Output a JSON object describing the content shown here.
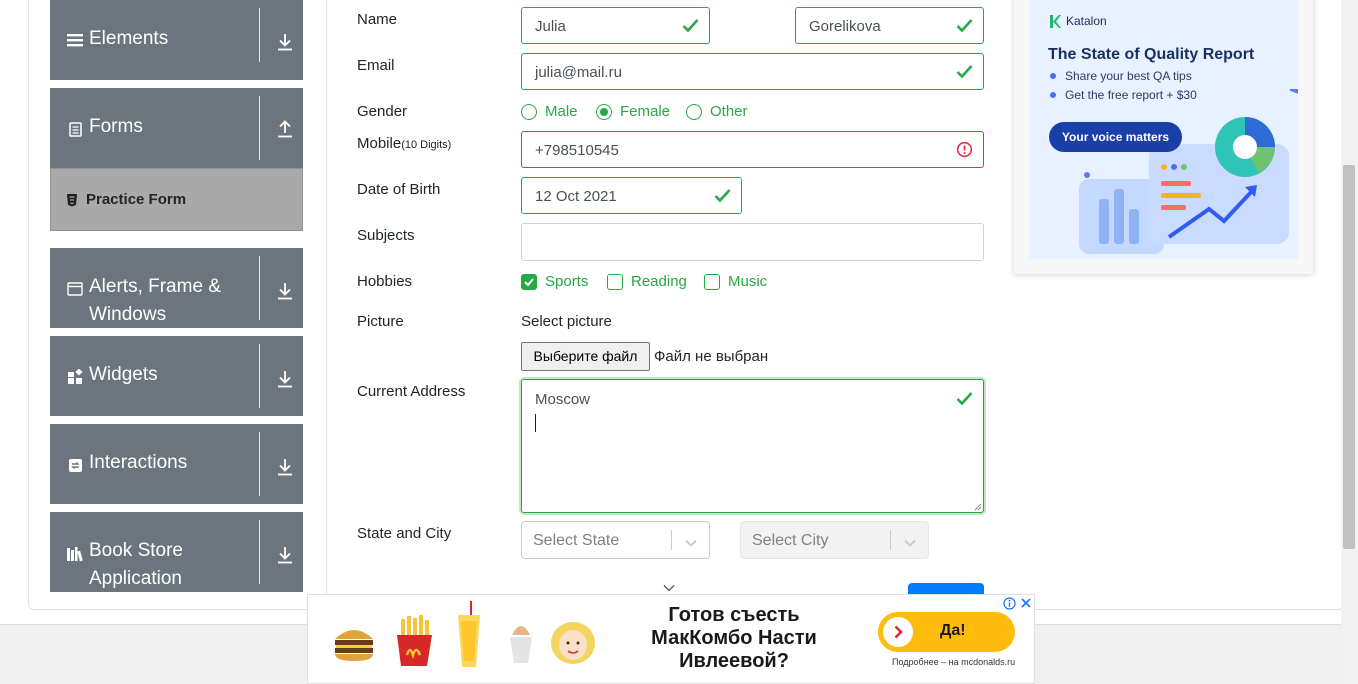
{
  "sidebar": {
    "groups": [
      {
        "label": "Elements",
        "icon": "hamburger-icon",
        "state": "collapsed"
      },
      {
        "label": "Forms",
        "icon": "document-icon",
        "state": "expanded"
      },
      {
        "label": "Alerts, Frame &",
        "label2": "Windows",
        "icon": "window-icon",
        "state": "collapsed"
      },
      {
        "label": "Widgets",
        "icon": "widgets-icon",
        "state": "collapsed"
      },
      {
        "label": "Interactions",
        "icon": "interactions-icon",
        "state": "collapsed"
      },
      {
        "label": "Book Store",
        "label2": "Application",
        "icon": "books-icon",
        "state": "collapsed"
      }
    ],
    "active_item": "Practice Form"
  },
  "form": {
    "name_label": "Name",
    "first_name": "Julia",
    "last_name": "Gorelikova",
    "email_label": "Email",
    "email": "julia@mail.ru",
    "gender_label": "Gender",
    "gender_options": [
      "Male",
      "Female",
      "Other"
    ],
    "gender_selected": "Female",
    "mobile_label": "Mobile",
    "mobile_hint": "(10 Digits)",
    "mobile": "+798510545",
    "dob_label": "Date of Birth",
    "dob": "12 Oct 2021",
    "subjects_label": "Subjects",
    "subjects": "",
    "hobbies_label": "Hobbies",
    "hobbies": [
      {
        "label": "Sports",
        "checked": true
      },
      {
        "label": "Reading",
        "checked": false
      },
      {
        "label": "Music",
        "checked": false
      }
    ],
    "picture_label": "Picture",
    "picture_prompt": "Select picture",
    "file_button": "Выберите файл",
    "file_status": "Файл не выбран",
    "address_label": "Current Address",
    "address": "Moscow",
    "state_city_label": "State and City",
    "state_placeholder": "Select State",
    "city_placeholder": "Select City"
  },
  "ad_right": {
    "brand": "Katalon",
    "title": "The State of Quality Report",
    "bullets": [
      "Share your best QA tips",
      "Get the free report + $30"
    ],
    "cta": "Your voice matters"
  },
  "ad_bottom": {
    "headline_lines": [
      "Готов съесть",
      "МакКомбо Насти",
      "Ивлеевой?"
    ],
    "button": "Да!",
    "note": "Подробнее – на mcdonalds.ru"
  },
  "colors": {
    "sidebar": "#6c757d",
    "sidebar_active": "#a9a9a9",
    "valid": "#28a745",
    "invalid": "#dc3545",
    "mcd_yellow": "#ffbc0d"
  }
}
